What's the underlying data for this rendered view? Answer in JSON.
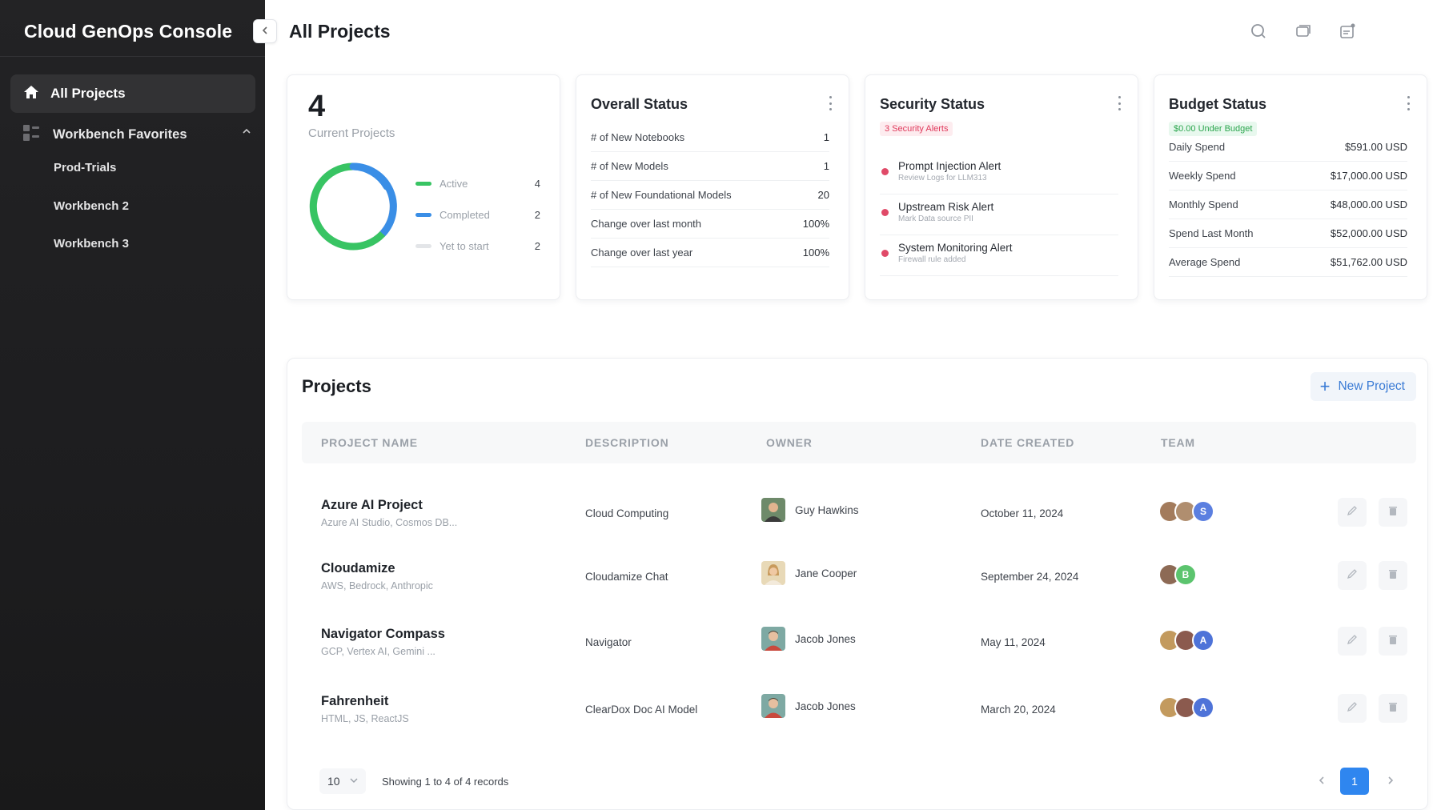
{
  "app": {
    "title": "Cloud GenOps Console"
  },
  "sidebar": {
    "active": {
      "label": "All Projects",
      "icon": "home-icon"
    },
    "group": {
      "label": "Workbench Favorites",
      "icon": "grid-icon",
      "expanded": true
    },
    "sub_items": [
      "Prod-Trials",
      "Workbench 2",
      "Workbench 3"
    ]
  },
  "header": {
    "title": "All Projects",
    "icons": [
      "search-icon",
      "chat-icon",
      "notification-icon"
    ]
  },
  "projects_card": {
    "count": "4",
    "label": "Current Projects",
    "legend": [
      {
        "label": "Active",
        "count": "4",
        "color": "#38c463"
      },
      {
        "label": "Completed",
        "count": "2",
        "color": "#3a8ee6"
      },
      {
        "label": "Yet to start",
        "count": "2",
        "color": "#e3e5e8"
      }
    ]
  },
  "overall_status": {
    "title": "Overall Status",
    "rows": [
      {
        "label": "# of New Notebooks",
        "value": "1"
      },
      {
        "label": "# of New Models",
        "value": "1"
      },
      {
        "label": "# of New Foundational Models",
        "value": "20"
      },
      {
        "label": "Change over last month",
        "value": "100%"
      },
      {
        "label": "Change over last year",
        "value": "100%"
      }
    ]
  },
  "security_status": {
    "title": "Security Status",
    "badge": "3 Security Alerts",
    "alerts": [
      {
        "title": "Prompt Injection Alert",
        "sub": "Review Logs for LLM313"
      },
      {
        "title": "Upstream Risk Alert",
        "sub": "Mark Data source PII"
      },
      {
        "title": "System Monitoring Alert",
        "sub": "Firewall rule added"
      }
    ]
  },
  "budget_status": {
    "title": "Budget Status",
    "badge": "$0.00 Under Budget",
    "rows": [
      {
        "label": "Daily Spend",
        "value": "$591.00 USD"
      },
      {
        "label": "Weekly Spend",
        "value": "$17,000.00 USD"
      },
      {
        "label": "Monthly Spend",
        "value": "$48,000.00 USD"
      },
      {
        "label": "Spend Last Month",
        "value": "$52,000.00 USD"
      },
      {
        "label": "Average Spend",
        "value": "$51,762.00 USD"
      }
    ]
  },
  "projects": {
    "title": "Projects",
    "new_button": "New Project",
    "columns": [
      "PROJECT NAME",
      "DESCRIPTION",
      "OWNER",
      "DATE CREATED",
      "TEAM"
    ],
    "rows": [
      {
        "name": "Azure AI Project",
        "sub": "Azure AI Studio, Cosmos DB...",
        "description": "Cloud Computing",
        "owner": "Guy Hawkins",
        "date": "October 11, 2024",
        "team_initial": "S",
        "team_color": "#5b7fe0"
      },
      {
        "name": "Cloudamize",
        "sub": "AWS, Bedrock, Anthropic",
        "description": "Cloudamize Chat",
        "owner": "Jane Cooper",
        "date": "September 24, 2024",
        "team_initial": "B",
        "team_color": "#5cc46e"
      },
      {
        "name": "Navigator Compass",
        "sub": "GCP, Vertex AI, Gemini ...",
        "description": "Navigator",
        "owner": "Jacob Jones",
        "date": "May 11, 2024",
        "team_initial": "A",
        "team_color": "#4e73d8"
      },
      {
        "name": "Fahrenheit",
        "sub": "HTML, JS, ReactJS",
        "description": "ClearDox Doc AI Model",
        "owner": "Jacob Jones",
        "date": "March 20, 2024",
        "team_initial": "A",
        "team_color": "#4e73d8"
      }
    ],
    "page_size": "10",
    "showing": "Showing 1 to 4 of 4 records",
    "current_page": "1"
  }
}
